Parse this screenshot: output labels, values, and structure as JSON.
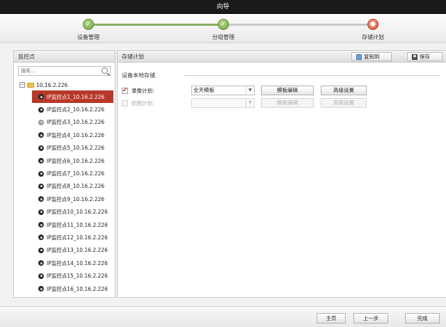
{
  "window": {
    "title": "向导"
  },
  "wizard": {
    "steps": [
      {
        "label": "设备管理",
        "state": "done"
      },
      {
        "label": "分组管理",
        "state": "done"
      },
      {
        "label": "存储计划",
        "state": "current"
      }
    ]
  },
  "left_panel": {
    "header": "监控点",
    "search_placeholder": "搜索...",
    "root": {
      "label": "10.16.2.226",
      "icon": "folder-icon"
    },
    "cameras": [
      {
        "label": "IP监控点1_10.16.2.226",
        "selected": true,
        "online": true
      },
      {
        "label": "IP监控点2_10.16.2.226",
        "selected": false,
        "online": true
      },
      {
        "label": "IP监控点3_10.16.2.226",
        "selected": false,
        "online": false
      },
      {
        "label": "IP监控点4_10.16.2.226",
        "selected": false,
        "online": true
      },
      {
        "label": "IP监控点5_10.16.2.226",
        "selected": false,
        "online": true
      },
      {
        "label": "IP监控点6_10.16.2.226",
        "selected": false,
        "online": true
      },
      {
        "label": "IP监控点7_10.16.2.226",
        "selected": false,
        "online": true
      },
      {
        "label": "IP监控点8_10.16.2.226",
        "selected": false,
        "online": true
      },
      {
        "label": "IP监控点9_10.16.2.226",
        "selected": false,
        "online": true
      },
      {
        "label": "IP监控点10_10.16.2.226",
        "selected": false,
        "online": true
      },
      {
        "label": "IP监控点11_10.16.2.226",
        "selected": false,
        "online": true
      },
      {
        "label": "IP监控点12_10.16.2.226",
        "selected": false,
        "online": true
      },
      {
        "label": "IP监控点13_10.16.2.226",
        "selected": false,
        "online": true
      },
      {
        "label": "IP监控点14_10.16.2.226",
        "selected": false,
        "online": true
      },
      {
        "label": "IP监控点15_10.16.2.226",
        "selected": false,
        "online": true
      },
      {
        "label": "IP监控点16_10.16.2.226",
        "selected": false,
        "online": true
      }
    ]
  },
  "right_panel": {
    "header": "存储计划",
    "copy_label": "复制到",
    "save_label": "保存",
    "section_title": "设备本地存储",
    "record_plan": {
      "label": "录像计划:",
      "checked": true,
      "template": "全天模板",
      "edit_label": "模板编辑",
      "advanced_label": "高级设置"
    },
    "capture_plan": {
      "label": "抓图计划:",
      "checked": false,
      "template": "",
      "edit_label": "模板编辑",
      "advanced_label": "高级设置"
    }
  },
  "footer": {
    "home_label": "主页",
    "prev_label": "上一步",
    "finish_label": "完成"
  },
  "colors": {
    "accent_selected": "#b8382a",
    "step_done": "#88b062",
    "step_current": "#d34b2c"
  }
}
